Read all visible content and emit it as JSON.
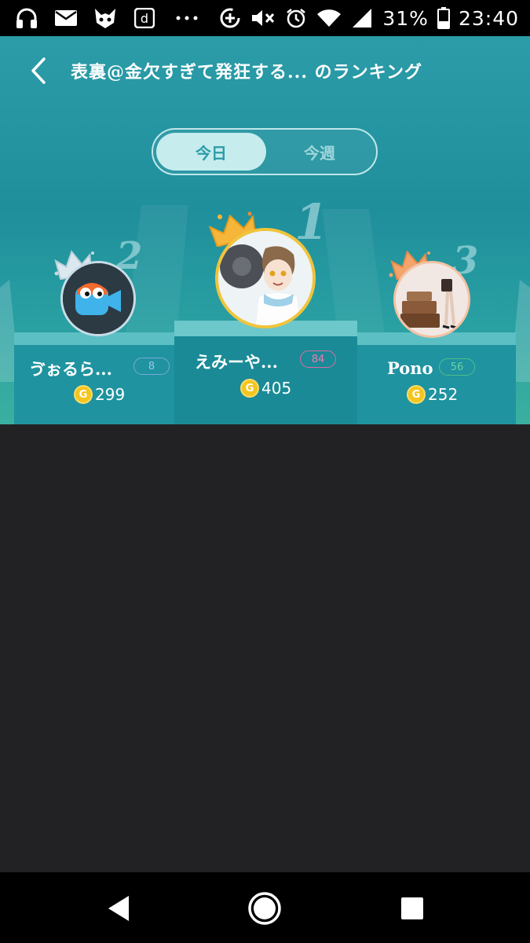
{
  "status_bar": {
    "left_icons": [
      "headphones-icon",
      "mail-icon",
      "app-mask-icon",
      "docomo-d-icon",
      "more-dots-icon"
    ],
    "right_icons": [
      "data-saver-icon",
      "mute-icon",
      "alarm-icon",
      "wifi-icon",
      "signal-icon",
      "battery-icon"
    ],
    "battery_text": "31%",
    "time": "23:40"
  },
  "header": {
    "title": "表裏@金欠すぎて発狂する... のランキング",
    "tabs": [
      {
        "label": "今日",
        "selected": true
      },
      {
        "label": "今週",
        "selected": false
      }
    ]
  },
  "ranking": [
    {
      "rank": "1",
      "name": "えみーや...",
      "badge": "84",
      "coins": "405",
      "badge_color": "#d66fa0",
      "crown_color": "#f2b43a"
    },
    {
      "rank": "2",
      "name": "ゔぉるら...",
      "badge": "8",
      "coins": "299",
      "badge_color": "#7aa8d8",
      "crown_color": "#d8e6ee"
    },
    {
      "rank": "3",
      "name": "Pono",
      "badge": "56",
      "coins": "252",
      "badge_color": "#4fc08a",
      "crown_color": "#f3a069"
    }
  ],
  "coin_glyph": "G",
  "colors": {
    "header_teal": "#2b9ca8",
    "tab_selected_bg": "#c6ecee",
    "background_dark": "#222224"
  },
  "nav_bar": {
    "buttons": [
      "back-triangle-icon",
      "home-circle-icon",
      "recents-square-icon"
    ]
  }
}
